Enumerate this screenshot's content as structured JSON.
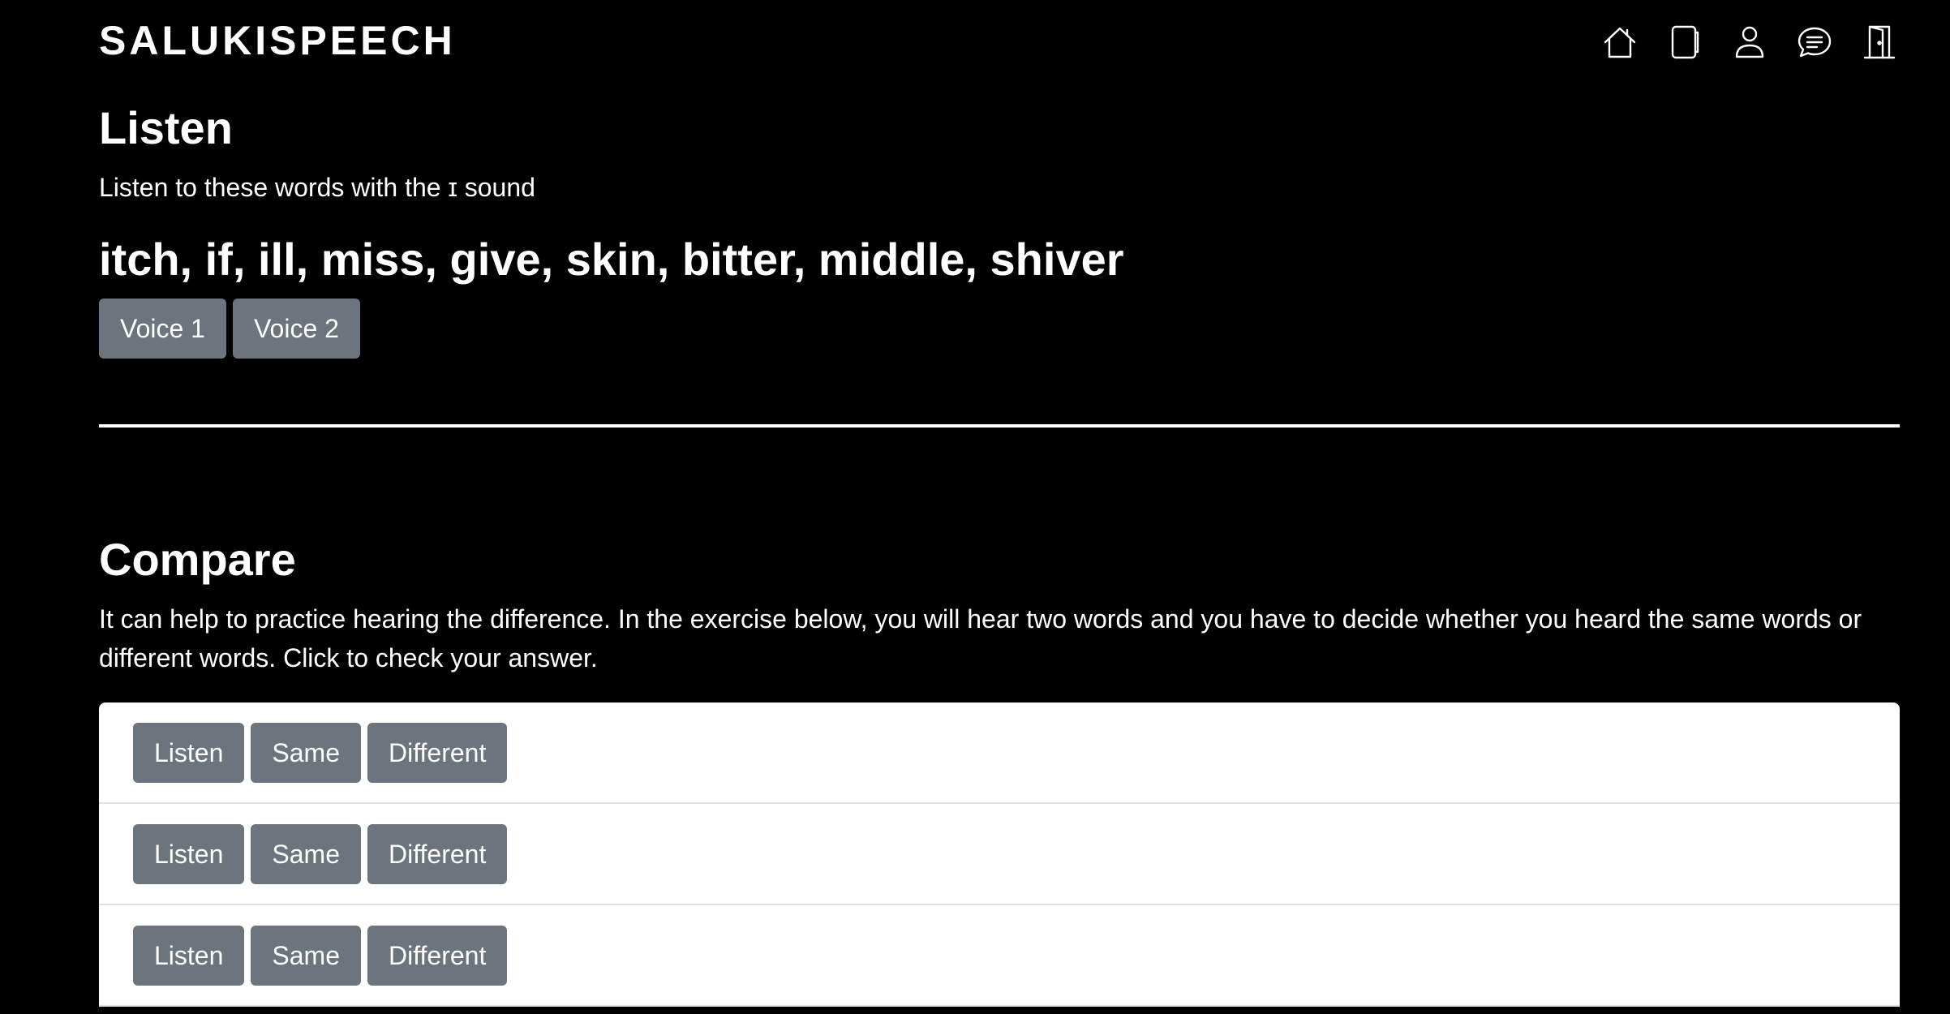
{
  "header": {
    "brand": "SALUKISPEECH",
    "nav": [
      {
        "icon": "home-icon"
      },
      {
        "icon": "journal-icon"
      },
      {
        "icon": "person-icon"
      },
      {
        "icon": "chat-icon"
      },
      {
        "icon": "door-icon"
      }
    ]
  },
  "listen": {
    "title": "Listen",
    "description": "Listen to these words with the ɪ sound",
    "words": "itch, if, ill, miss, give, skin, bitter, middle, shiver",
    "voice1_label": "Voice 1",
    "voice2_label": "Voice 2"
  },
  "compare": {
    "title": "Compare",
    "description": "It can help to practice hearing the difference. In the exercise below, you will hear two words and you have to decide whether you heard the same words or different words. Click to check your answer.",
    "rows": [
      {
        "listen": "Listen",
        "same": "Same",
        "different": "Different"
      },
      {
        "listen": "Listen",
        "same": "Same",
        "different": "Different"
      },
      {
        "listen": "Listen",
        "same": "Same",
        "different": "Different"
      }
    ]
  },
  "colors": {
    "background": "#000000",
    "text": "#ffffff",
    "button": "#6c757d",
    "card": "#ffffff",
    "row_border": "#dee2e6"
  }
}
